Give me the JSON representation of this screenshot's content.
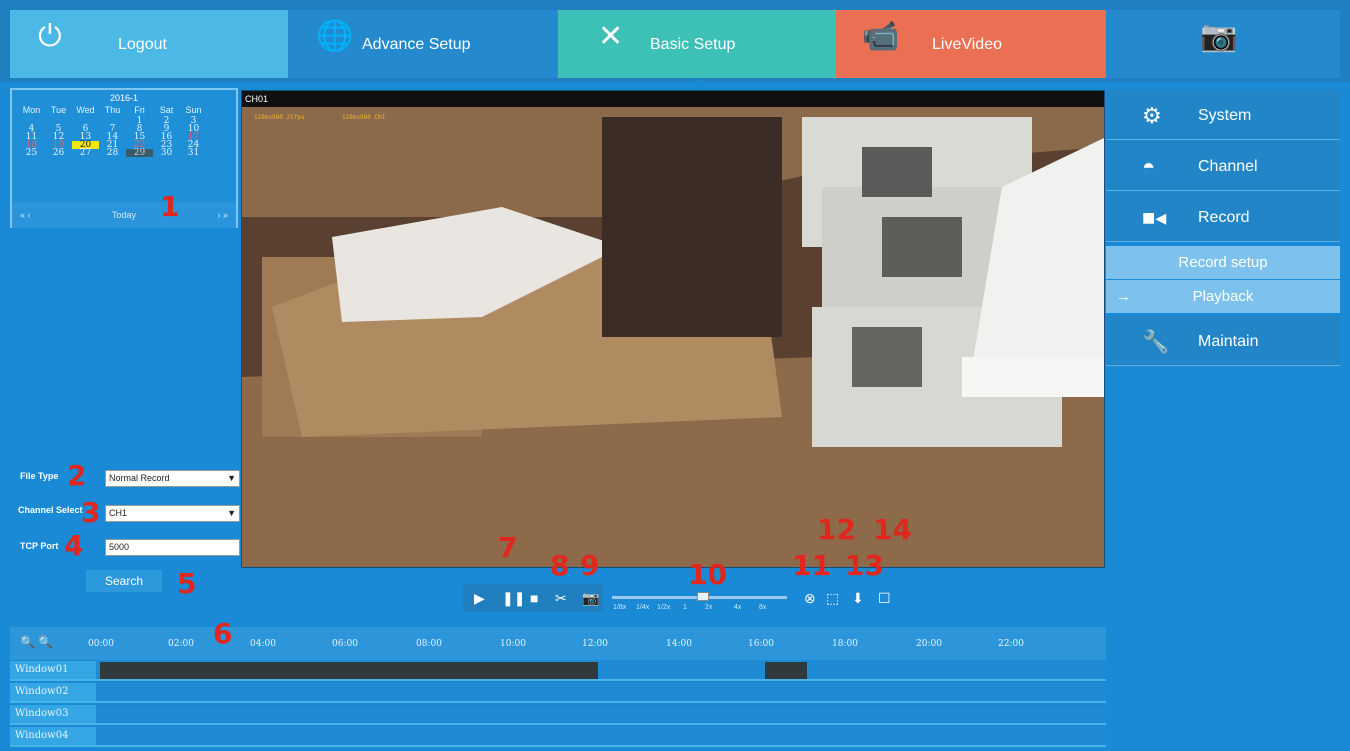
{
  "topbar": {
    "tabs": [
      {
        "label": "Logout",
        "icon": "power-icon"
      },
      {
        "label": "Advance Setup",
        "icon": "globe-icon"
      },
      {
        "label": "Basic Setup",
        "icon": "tools-icon"
      },
      {
        "label": "LiveVideo",
        "icon": "video-camera-icon"
      },
      {
        "label": "",
        "icon": "camera-logo-icon"
      }
    ]
  },
  "calendar": {
    "title": "2016-1",
    "weekdays": [
      "Mon",
      "Tue",
      "Wed",
      "Thu",
      "Fri",
      "Sat",
      "Sun"
    ],
    "rows": [
      [
        "",
        "",
        "",
        "",
        "1",
        "2",
        "3"
      ],
      [
        "4",
        "5",
        "6",
        "7",
        "8",
        "9",
        "10"
      ],
      [
        "11",
        "12",
        "13",
        "14",
        "15",
        "16",
        "17"
      ],
      [
        "18",
        "19",
        "20",
        "21",
        "22",
        "23",
        "24"
      ],
      [
        "25",
        "26",
        "27",
        "28",
        "29",
        "30",
        "31"
      ]
    ],
    "today_label": "Today",
    "prev": "« ‹",
    "next": "› »"
  },
  "search_form": {
    "file_type_label": "File Type",
    "file_type_value": "Normal Record",
    "channel_label": "Channel Select",
    "channel_value": "CH1",
    "tcp_label": "TCP Port",
    "tcp_value": "5000",
    "search_button": "Search"
  },
  "video": {
    "channel": "CH01",
    "osd_left": "1280x960   25fps",
    "osd_right": "1280x960   CH1"
  },
  "annotations": [
    "1",
    "2",
    "3",
    "4",
    "5",
    "6",
    "7",
    "8",
    "9",
    "10",
    "11",
    "12",
    "13",
    "14"
  ],
  "playback": {
    "speeds": [
      "1/8x",
      "1/4x",
      "1/2x",
      "1",
      "2x",
      "4x",
      "8x"
    ]
  },
  "right_menu": {
    "system": "System",
    "channel": "Channel",
    "record": "Record",
    "record_setup": "Record setup",
    "playback": "Playback",
    "arrow": "→",
    "maintain": "Maintain"
  },
  "timeline": {
    "ticks": [
      "00:00",
      "02:00",
      "04:00",
      "06:00",
      "08:00",
      "10:00",
      "12:00",
      "14:00",
      "16:00",
      "18:00",
      "20:00",
      "22:00"
    ],
    "windows": [
      "Window01",
      "Window02",
      "Window03",
      "Window04"
    ]
  },
  "colors": {
    "accent": "#1a8ad6",
    "logout": "#4bb8e6",
    "basic": "#3dc0b5",
    "live": "#ea6f53",
    "annotation": "#e0261d"
  }
}
